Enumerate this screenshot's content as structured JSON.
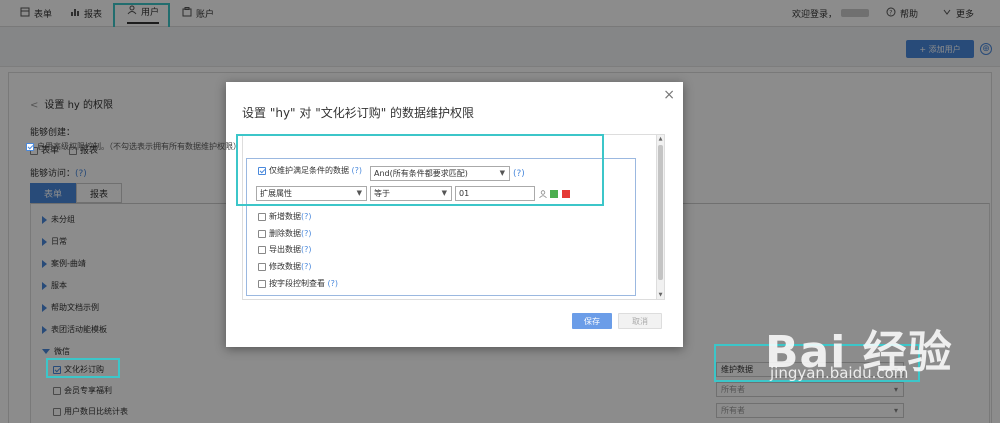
{
  "topnav": {
    "items": [
      "表单",
      "报表",
      "用户",
      "账户"
    ],
    "welcome": "欢迎登录，",
    "help": "帮助",
    "more": "更多"
  },
  "subbar": {
    "add_user": "+ 添加用户",
    "add_icon": "⊕"
  },
  "settings": {
    "back_title": "设置 hy 的权限",
    "can_create": "能够创建：",
    "create_options": [
      "表单",
      "报表"
    ],
    "can_access": "能够访问：",
    "help_mark": "(?)",
    "tabs": [
      "表单",
      "报表"
    ],
    "tree": [
      "未分组",
      "日常",
      "案例-曲靖",
      "服本",
      "帮助文档示例",
      "表团活动能模板",
      "微信"
    ],
    "sub_items": [
      "文化衫订购",
      "会员专享福利",
      "用户数日比统计表"
    ],
    "right_selects": [
      "维护数据",
      "所有者",
      "所有者"
    ]
  },
  "dialog": {
    "title": "设置 \"hy\" 对 \"文化衫订购\" 的数据维护权限",
    "close": "×",
    "adv_label": "启用高级权限控制。（不勾选表示拥有所有数据维护权限）",
    "cond_label": "仅维护满足条件的数据",
    "help_mark": "(?)",
    "cond_mode": "And(所有条件都要求匹配)",
    "field": "扩展属性",
    "operator": "等于",
    "value": "01",
    "permissions": [
      "新增数据",
      "删除数据",
      "导出数据",
      "修改数据",
      "按字段控制查看"
    ],
    "save": "保存",
    "cancel": "取消"
  },
  "watermark": {
    "brand": "Bai 经验",
    "url": "jingyan.baidu.com"
  },
  "colors": {
    "accent": "#4a89dc",
    "highlight": "#3cc6c9"
  }
}
